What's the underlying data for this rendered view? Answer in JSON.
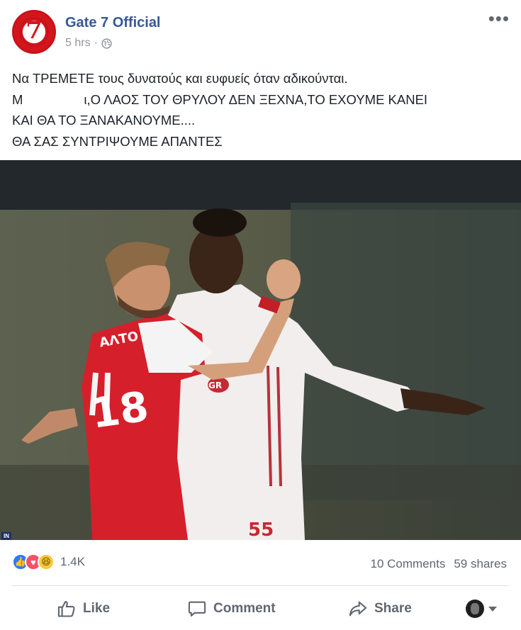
{
  "post": {
    "page_name": "Gate 7 Official",
    "avatar_text": "7",
    "time": "5 hrs",
    "separator": "·",
    "audience_icon": "globe-icon",
    "more_icon": "more-options-icon",
    "more_label": "•••",
    "text": {
      "line1": "Να ΤΡΕΜΕΤΕ τους δυνατούς και ευφυείς όταν αδικούνται.",
      "line2_prefix": "Μ",
      "line2_suffix": "ι,Ο ΛΑΟΣ ΤΟΥ ΘΡΥΛΟΥ ΔΕΝ ΞΕΧΝΑ,ΤΟ ΕΧΟΥΜΕ ΚΑΝΕΙ",
      "line3": "ΚΑΙ ΘΑ ΤΟ ΞΑΝΑΚΑΝΟΥΜΕ....",
      "line4": "ΘΑ ΣΑΣ ΣΥΝΤΡΙΨΟΥΜΕ ΑΠΑΝΤΕΣ"
    },
    "photo": {
      "jersey_number": "18",
      "jersey_name": "ΑΛΤΟ",
      "other_number": "55",
      "sponsor": "GR",
      "watermark": "IN"
    }
  },
  "reactions": {
    "icons": [
      "like-reaction-icon",
      "love-reaction-icon",
      "haha-reaction-icon"
    ],
    "like_glyph": "👍",
    "love_glyph": "♥",
    "haha_glyph": "😆",
    "count": "1.4K"
  },
  "stats": {
    "comments": "10 Comments",
    "shares": "59 shares"
  },
  "actions": {
    "like": "Like",
    "comment": "Comment",
    "share": "Share"
  },
  "colors": {
    "link": "#365899",
    "secondary_text": "#90949c",
    "action_text": "#606770",
    "like_blue": "#2d7bf6",
    "love_red": "#f25268",
    "haha_yellow": "#f7c93a"
  }
}
